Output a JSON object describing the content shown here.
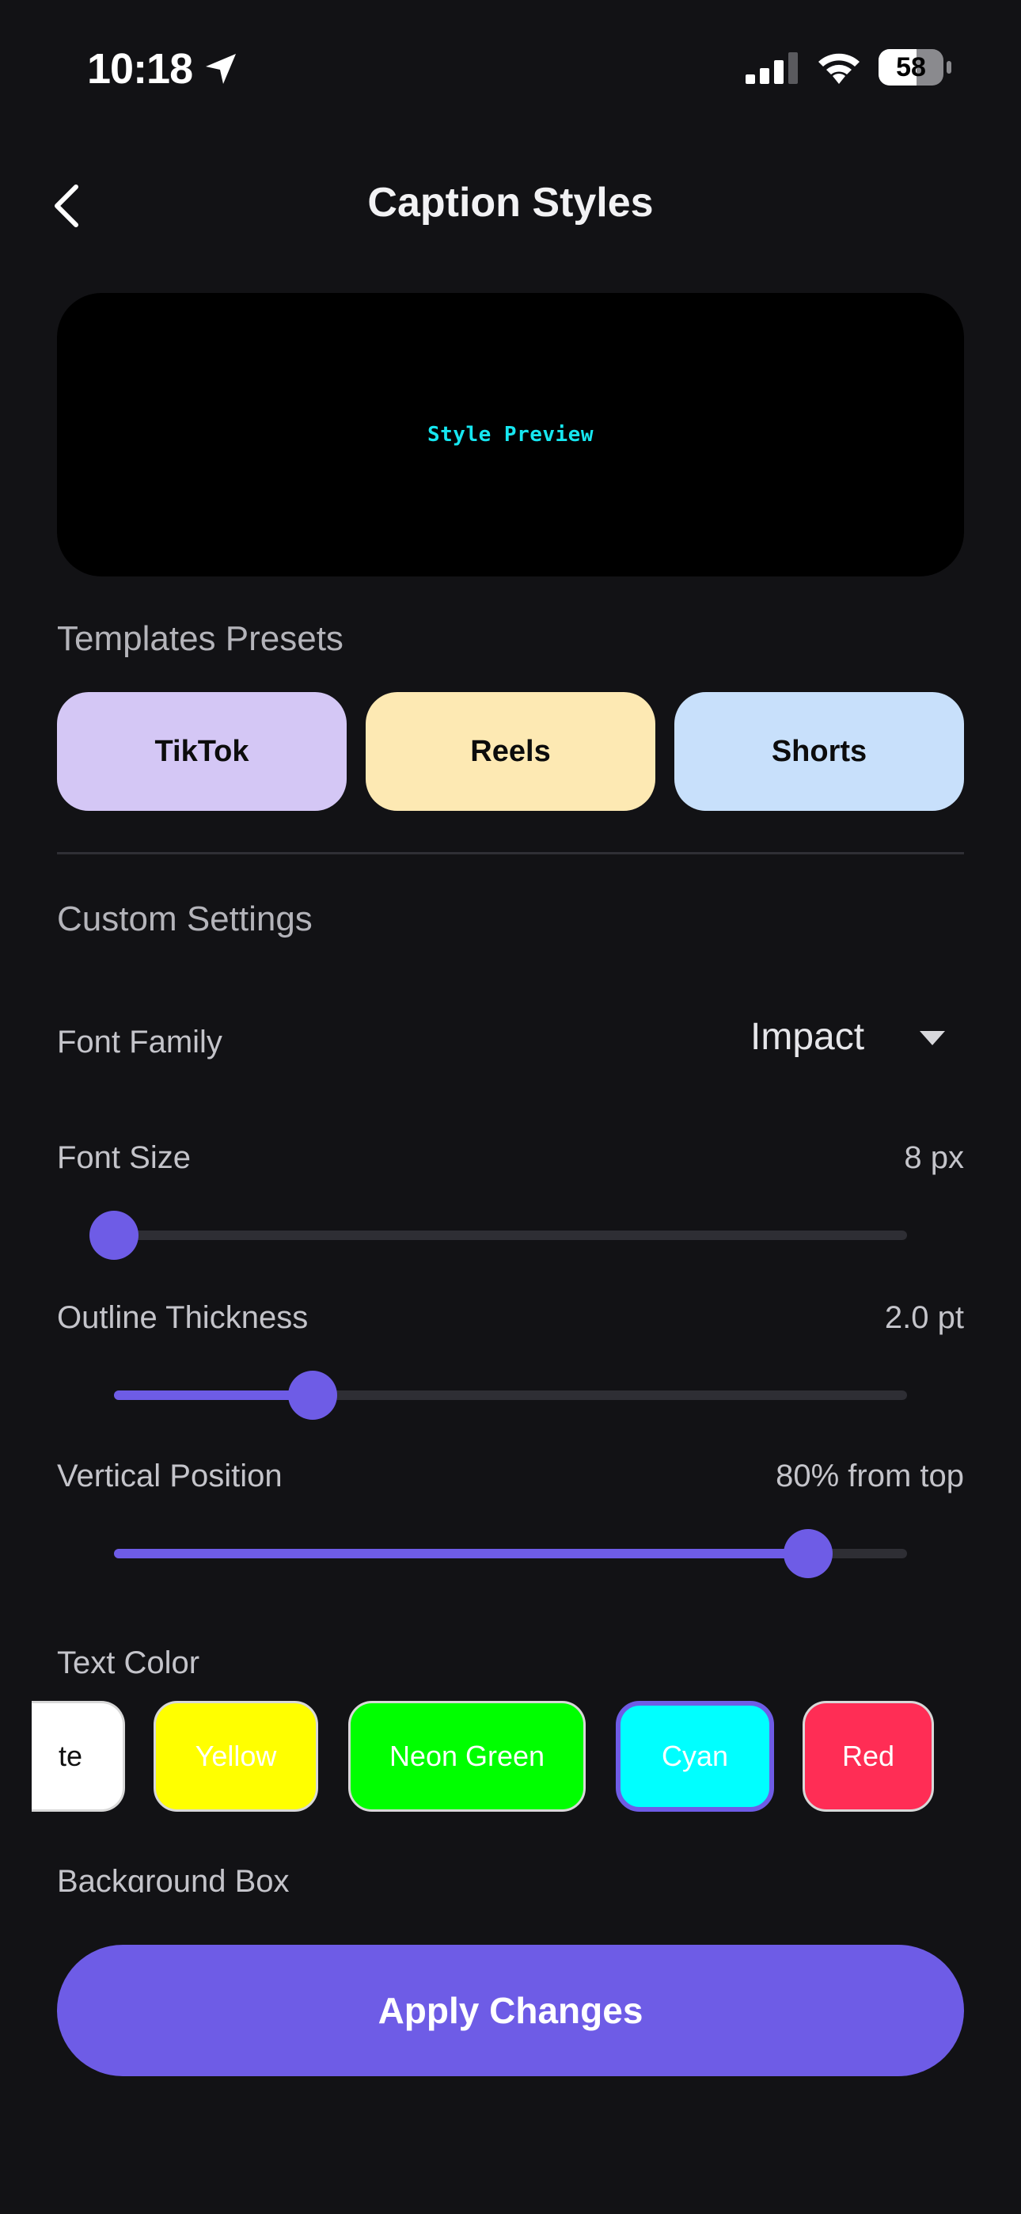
{
  "status_bar": {
    "time": "10:18",
    "battery": "58",
    "battery_level": 0.58,
    "icons": [
      "location-arrow-icon",
      "cellular-signal-icon",
      "wifi-icon",
      "battery-icon"
    ]
  },
  "header": {
    "title": "Caption Styles",
    "back_icon": "chevron-left-icon"
  },
  "preview": {
    "text": "Style Preview",
    "text_color": "#16e6f0"
  },
  "presets": {
    "label": "Templates Presets",
    "items": [
      {
        "label": "TikTok",
        "color": "#d4c7f5"
      },
      {
        "label": "Reels",
        "color": "#fde9b3"
      },
      {
        "label": "Shorts",
        "color": "#c8e0fb"
      }
    ]
  },
  "custom": {
    "label": "Custom Settings",
    "font_family": {
      "label": "Font Family",
      "value": "Impact"
    },
    "font_size": {
      "label": "Font Size",
      "value": "8 px",
      "level": 0.0
    },
    "outline_thickness": {
      "label": "Outline Thickness",
      "value": "2.0 pt",
      "level": 0.25
    },
    "vertical_position": {
      "label": "Vertical Position",
      "value": "80% from top",
      "level": 0.875
    }
  },
  "text_color": {
    "label": "Text Color",
    "options": [
      {
        "label": "te",
        "color": "#ffffff"
      },
      {
        "label": "Yellow",
        "color": "#ffff00"
      },
      {
        "label": "Neon Green",
        "color": "#00ff00"
      },
      {
        "label": "Cyan",
        "color": "#00ffff",
        "selected": true
      },
      {
        "label": "Red",
        "color": "#ff2d55"
      }
    ]
  },
  "background_box": {
    "label": "Background Box"
  },
  "apply_button": {
    "label": "Apply Changes"
  },
  "accent_color": "#6e5ce6"
}
